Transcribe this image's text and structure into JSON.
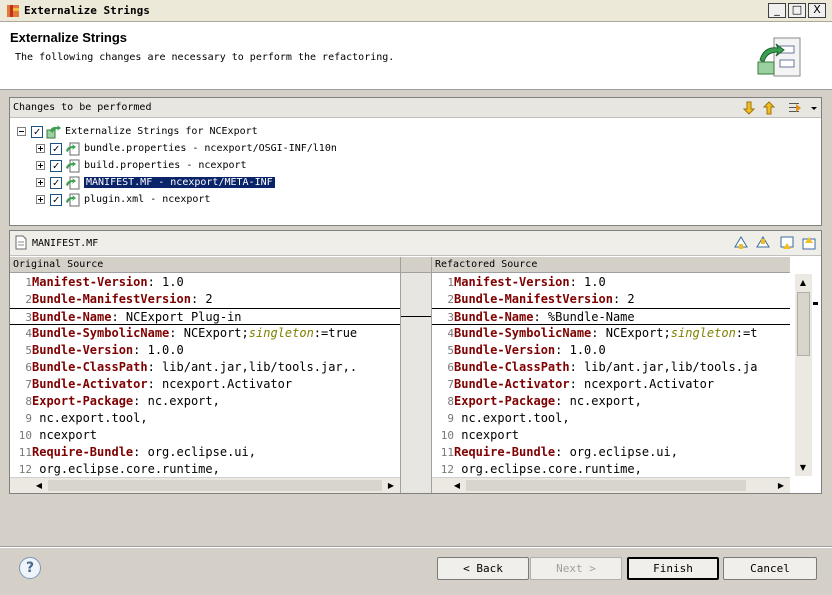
{
  "window": {
    "title": "Externalize Strings",
    "controls": [
      "_",
      "□",
      "X"
    ]
  },
  "header": {
    "title": "Externalize Strings",
    "description": "The following changes are necessary to perform the refactoring."
  },
  "changes": {
    "label": "Changes to be performed",
    "root": {
      "label": "Externalize Strings for NCExport",
      "checked": "✓"
    },
    "items": [
      {
        "label": "bundle.properties - ncexport/OSGI-INF/l10n",
        "checked": "✓"
      },
      {
        "label": "build.properties - ncexport",
        "checked": "✓"
      },
      {
        "label": "MANIFEST.MF - ncexport/META-INF",
        "checked": "✓",
        "selected": true
      },
      {
        "label": "plugin.xml - ncexport",
        "checked": "✓"
      }
    ]
  },
  "compare": {
    "file_label": "MANIFEST.MF",
    "original_header": "Original Source",
    "refactored_header": "Refactored Source"
  },
  "original_lines": [
    {
      "n": "1",
      "key": "Manifest-Version",
      "rest": ": 1.0"
    },
    {
      "n": "2",
      "key": "Bundle-ManifestVersion",
      "rest": ": 2"
    },
    {
      "n": "3",
      "key": "Bundle-Name",
      "rest": ": NCExport Plug-in"
    },
    {
      "n": "4",
      "key": "Bundle-SymbolicName",
      "rest": ": NCExport;",
      "dir": "singleton",
      "rest2": ":=true"
    },
    {
      "n": "5",
      "key": "Bundle-Version",
      "rest": ": 1.0.0"
    },
    {
      "n": "6",
      "key": "Bundle-ClassPath",
      "rest": ": lib/ant.jar,lib/tools.jar,."
    },
    {
      "n": "7",
      "key": "Bundle-Activator",
      "rest": ": ncexport.Activator"
    },
    {
      "n": "8",
      "key": "Export-Package",
      "rest": ": nc.export,"
    },
    {
      "n": "9",
      "key": "",
      "rest": " nc.export.tool,"
    },
    {
      "n": "10",
      "key": "",
      "rest": " ncexport"
    },
    {
      "n": "11",
      "key": "Require-Bundle",
      "rest": ": org.eclipse.ui,"
    },
    {
      "n": "12",
      "key": "",
      "rest": " org.eclipse.core.runtime,"
    }
  ],
  "refactored_lines": [
    {
      "n": "1",
      "key": "Manifest-Version",
      "rest": ": 1.0"
    },
    {
      "n": "2",
      "key": "Bundle-ManifestVersion",
      "rest": ": 2"
    },
    {
      "n": "3",
      "key": "Bundle-Name",
      "rest": ": %Bundle-Name"
    },
    {
      "n": "4",
      "key": "Bundle-SymbolicName",
      "rest": ": NCExport;",
      "dir": "singleton",
      "rest2": ":=t"
    },
    {
      "n": "5",
      "key": "Bundle-Version",
      "rest": ": 1.0.0"
    },
    {
      "n": "6",
      "key": "Bundle-ClassPath",
      "rest": ": lib/ant.jar,lib/tools.ja"
    },
    {
      "n": "7",
      "key": "Bundle-Activator",
      "rest": ": ncexport.Activator"
    },
    {
      "n": "8",
      "key": "Export-Package",
      "rest": ": nc.export,"
    },
    {
      "n": "9",
      "key": "",
      "rest": " nc.export.tool,"
    },
    {
      "n": "10",
      "key": "",
      "rest": " ncexport"
    },
    {
      "n": "11",
      "key": "Require-Bundle",
      "rest": ": org.eclipse.ui,"
    },
    {
      "n": "12",
      "key": "",
      "rest": " org.eclipse.core.runtime,"
    }
  ],
  "buttons": {
    "back": "< Back",
    "next": "Next >",
    "finish": "Finish",
    "cancel": "Cancel",
    "help": "?"
  },
  "colors": {
    "key": "#7f0000",
    "directive": "#7f7f00",
    "selection": "#0a246a"
  }
}
